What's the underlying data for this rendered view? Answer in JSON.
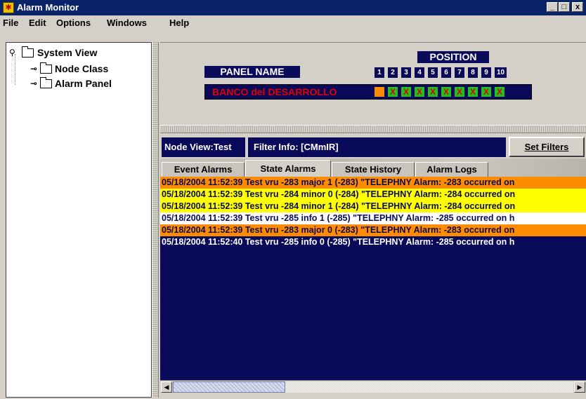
{
  "window": {
    "title": "Alarm Monitor",
    "controls": {
      "minimize": "_",
      "maximize": "□",
      "close": "x"
    }
  },
  "menu": [
    "File",
    "Edit",
    "Options",
    "Windows",
    "Help"
  ],
  "tree": {
    "root": "System View",
    "children": [
      "Node Class",
      "Alarm Panel"
    ]
  },
  "panel": {
    "position_label": "POSITION",
    "panel_name_label": "PANEL NAME",
    "positions": [
      "1",
      "2",
      "3",
      "4",
      "5",
      "6",
      "7",
      "8",
      "9",
      "10"
    ],
    "panel_name": "BANCO del DESARROLLO",
    "slot_states": [
      "orange",
      "green",
      "green",
      "green",
      "green",
      "green",
      "green",
      "green",
      "green",
      "green"
    ],
    "slot_mark": "X"
  },
  "node_bar": {
    "node_view": "Node View:Test",
    "filter_info": "Filter Info: [CMmIR]",
    "set_filters": "Set Filters"
  },
  "tabs": [
    {
      "label": "Event Alarms",
      "active": false
    },
    {
      "label": "State Alarms",
      "active": true
    },
    {
      "label": "State History",
      "active": false
    },
    {
      "label": "Alarm Logs",
      "active": false
    }
  ],
  "alarms": [
    {
      "text": "05/18/2004 11:52:39 Test vru -283 major 1 (-283) \"TELEPHNY  Alarm: -283 occurred on",
      "bg": "#ff8c00",
      "fg": "#0a0a5a"
    },
    {
      "text": "05/18/2004 11:52:39 Test vru -284 minor 0 (-284) \"TELEPHNY  Alarm: -284 occurred on",
      "bg": "#ffff00",
      "fg": "#0a0a5a"
    },
    {
      "text": "05/18/2004 11:52:39 Test vru -284 minor 1 (-284) \"TELEPHNY  Alarm: -284 occurred on",
      "bg": "#ffff00",
      "fg": "#0a0a5a"
    },
    {
      "text": "05/18/2004 11:52:39 Test vru -285 info 1 (-285) \"TELEPHNY  Alarm: -285 occurred on h",
      "bg": "#ffffff",
      "fg": "#0a0a5a"
    },
    {
      "text": "05/18/2004 11:52:39 Test vru -283 major 0 (-283) \"TELEPHNY  Alarm: -283 occurred on",
      "bg": "#ff8c00",
      "fg": "#0a0a5a"
    },
    {
      "text": "05/18/2004 11:52:40 Test vru -285 info 0 (-285) \"TELEPHNY  Alarm: -285 occurred on h",
      "bg": "#0a0a5a",
      "fg": "#ffffff"
    }
  ],
  "scrollbar": {
    "left_arrow": "◀",
    "right_arrow": "▶"
  }
}
